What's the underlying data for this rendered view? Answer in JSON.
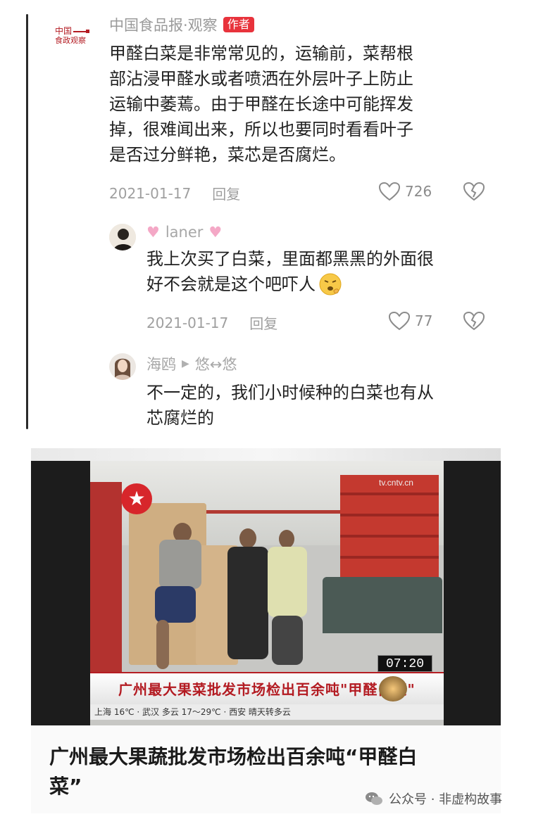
{
  "thread": {
    "main": {
      "logo_text": [
        "中国",
        "食政观察"
      ],
      "name": "中国食品报·观察",
      "tag": "作者",
      "lines": [
        "甲醛白菜是非常常见的，运输前，菜帮根",
        "部沾浸甲醛水或者喷洒在外层叶子上防止",
        "运输中萎蔫。由于甲醛在长途中可能挥发",
        "掉，很难闻出来，所以也要同时看看叶子",
        "是否过分鲜艳，菜芯是否腐烂。"
      ],
      "date": "2021-01-17",
      "reply": "回复",
      "likes": "726"
    },
    "reply1": {
      "name": "laner",
      "lines": [
        "我上次买了白菜，里面都黑黑的外面很",
        "好不会就是这个吧吓人"
      ],
      "date": "2021-01-17",
      "reply": "回复",
      "likes": "77"
    },
    "reply2": {
      "name": "海鸥",
      "reply_to": "悠↔悠",
      "lines": [
        "不一定的，我们小时候种的白菜也有从",
        "芯腐烂的"
      ]
    }
  },
  "video": {
    "watermark": "tv.cntv.cn",
    "clock": "07:20",
    "caption": "广州最大果菜批发市场检出百余吨\"甲醛白菜\"",
    "ticker": "上海 16℃ · 武汉 多云 17～29℃ · 西安 晴天转多云"
  },
  "article": {
    "title": "广州最大果蔬批发市场检出百余吨“甲醛白菜”"
  },
  "footer": {
    "text": "公众号 · 非虚构故事"
  },
  "colors": {
    "author_tag": "#e8333c",
    "meta_gray": "#9f9f9f",
    "brand_red": "#b31b22"
  }
}
